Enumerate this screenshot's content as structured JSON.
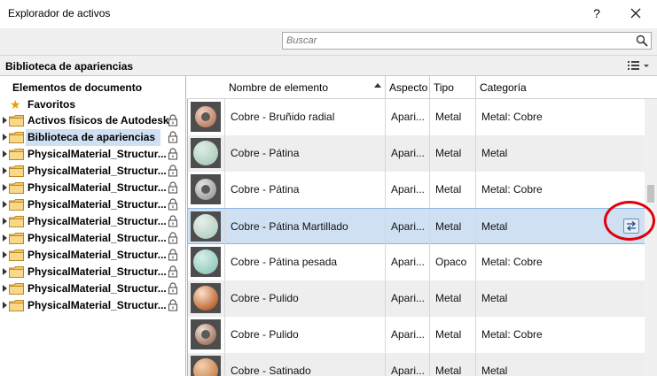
{
  "window": {
    "title": "Explorador de activos",
    "help_label": "?"
  },
  "search": {
    "placeholder": "Buscar"
  },
  "library": {
    "title": "Biblioteca de apariencias"
  },
  "tree": {
    "items": [
      {
        "label": "Elementos de documento",
        "kind": "root",
        "locked": false
      },
      {
        "label": "Favoritos",
        "kind": "favorites",
        "locked": false
      },
      {
        "label": "Activos físicos de Autodesk",
        "kind": "folder",
        "locked": true
      },
      {
        "label": "Biblioteca de apariencias",
        "kind": "folder",
        "locked": true,
        "selected": true
      },
      {
        "label": "PhysicalMaterial_Structur...",
        "kind": "folder",
        "locked": true
      },
      {
        "label": "PhysicalMaterial_Structur...",
        "kind": "folder",
        "locked": true
      },
      {
        "label": "PhysicalMaterial_Structur...",
        "kind": "folder",
        "locked": true
      },
      {
        "label": "PhysicalMaterial_Structur...",
        "kind": "folder",
        "locked": true
      },
      {
        "label": "PhysicalMaterial_Structur...",
        "kind": "folder",
        "locked": true
      },
      {
        "label": "PhysicalMaterial_Structur...",
        "kind": "folder",
        "locked": true
      },
      {
        "label": "PhysicalMaterial_Structur...",
        "kind": "folder",
        "locked": true
      },
      {
        "label": "PhysicalMaterial_Structur...",
        "kind": "folder",
        "locked": true
      },
      {
        "label": "PhysicalMaterial_Structur...",
        "kind": "folder",
        "locked": true
      },
      {
        "label": "PhysicalMaterial_Structur...",
        "kind": "folder",
        "locked": true
      }
    ]
  },
  "table": {
    "columns": [
      "Nombre de elemento",
      "Aspecto",
      "Tipo",
      "Categoría"
    ],
    "rows": [
      {
        "name": "Cobre - Bruñido radial",
        "aspect": "Apari...",
        "type": "Metal",
        "category": "Metal: Cobre",
        "swatch": "copper-swirl"
      },
      {
        "name": "Cobre - Pátina",
        "aspect": "Apari...",
        "type": "Metal",
        "category": "Metal",
        "swatch": "patina"
      },
      {
        "name": "Cobre - Pátina",
        "aspect": "Apari...",
        "type": "Metal",
        "category": "Metal: Cobre",
        "swatch": "patina-ring"
      },
      {
        "name": "Cobre - Pátina Martillado",
        "aspect": "Apari...",
        "type": "Metal",
        "category": "Metal",
        "swatch": "patina-hammered",
        "selected": true
      },
      {
        "name": "Cobre - Pátina pesada",
        "aspect": "Apari...",
        "type": "Opaco",
        "category": "Metal: Cobre",
        "swatch": "patina-heavy"
      },
      {
        "name": "Cobre - Pulido",
        "aspect": "Apari...",
        "type": "Metal",
        "category": "Metal",
        "swatch": "copper-polished"
      },
      {
        "name": "Cobre - Pulido",
        "aspect": "Apari...",
        "type": "Metal",
        "category": "Metal: Cobre",
        "swatch": "copper-ring"
      },
      {
        "name": "Cobre - Satinado",
        "aspect": "Apari...",
        "type": "Metal",
        "category": "Metal",
        "swatch": "copper-satin"
      }
    ]
  },
  "colors": {
    "selection": "#cfe0f2",
    "highlight": "#e0000e",
    "copper": "#c8784a",
    "patina": "#b9d4c8"
  }
}
